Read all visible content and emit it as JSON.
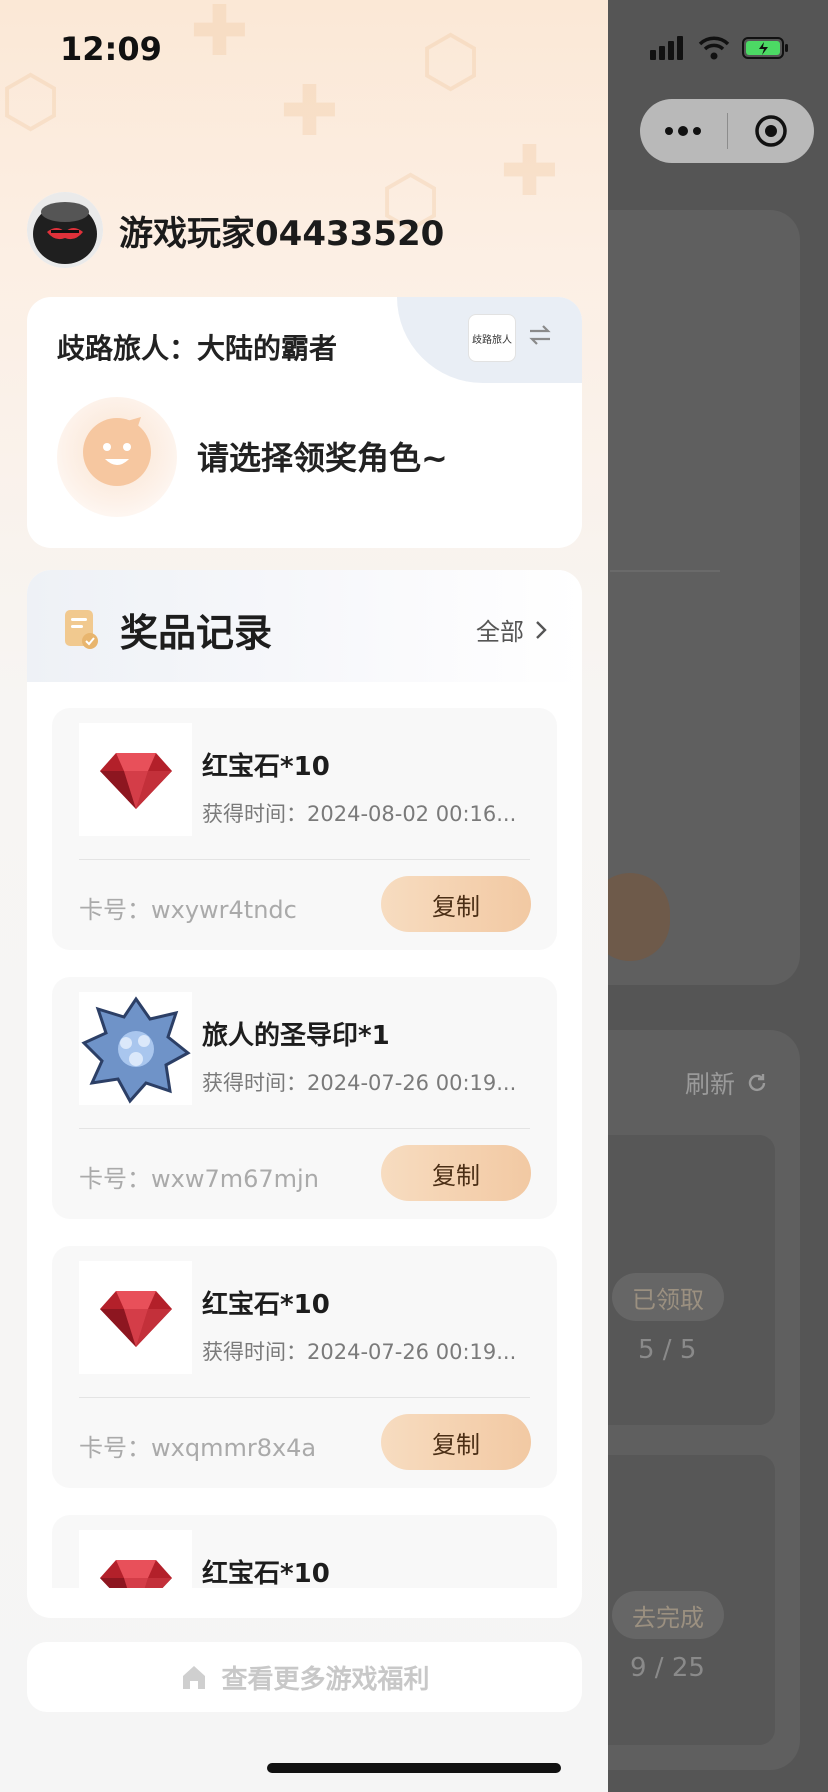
{
  "status_bar": {
    "time": "12:09"
  },
  "user": {
    "name": "游戏玩家04433520"
  },
  "game": {
    "title": "歧路旅人：大陆的霸者",
    "logo_text": "歧路旅人",
    "role_prompt": "请选择领奖角色~"
  },
  "records": {
    "title": "奖品记录",
    "all_label": "全部",
    "items": [
      {
        "name": "红宝石*10",
        "time": "获得时间：2024-08-02 00:16...",
        "card": "卡号：wxywr4tndc",
        "copy": "复制",
        "icon": "ruby"
      },
      {
        "name": "旅人的圣导印*1",
        "time": "获得时间：2024-07-26 00:19...",
        "card": "卡号：wxw7m67mjn",
        "copy": "复制",
        "icon": "blue-seal"
      },
      {
        "name": "红宝石*10",
        "time": "获得时间：2024-07-26 00:19...",
        "card": "卡号：wxqmmr8x4a",
        "copy": "复制",
        "icon": "ruby"
      },
      {
        "name": "红宝石*10",
        "time": "",
        "card": "",
        "copy": "",
        "icon": "ruby"
      }
    ]
  },
  "more_label": "查看更多游戏福利",
  "background": {
    "refresh_label": "刷新",
    "task1_status": "已领取",
    "task1_count": "5 / 5",
    "task2_status": "去完成",
    "task2_count": "9 / 25"
  },
  "colors": {
    "accent_button": "#f2c9a3",
    "overlay": "#4a4a4a",
    "battery": "#4cd964"
  }
}
